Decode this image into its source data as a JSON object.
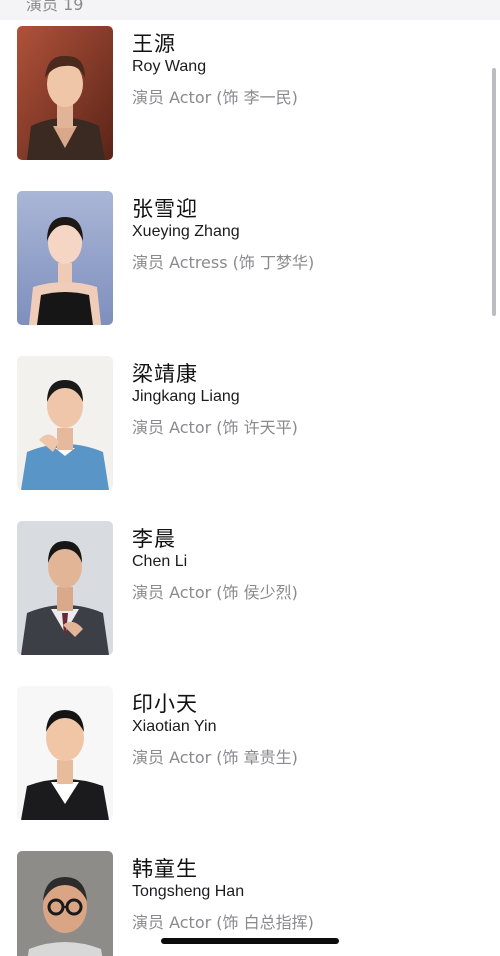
{
  "section": {
    "label": "演员 19"
  },
  "cast": [
    {
      "name_cn": "王源",
      "name_en": "Roy Wang",
      "role": "演员 Actor (饰 李一民)",
      "photo_icon": "actor-portrait-roy-wang"
    },
    {
      "name_cn": "张雪迎",
      "name_en": "Xueying Zhang",
      "role": "演员 Actress (饰 丁梦华)",
      "photo_icon": "actress-portrait-xueying-zhang"
    },
    {
      "name_cn": "梁靖康",
      "name_en": "Jingkang Liang",
      "role": "演员 Actor (饰 许天平)",
      "photo_icon": "actor-portrait-jingkang-liang"
    },
    {
      "name_cn": "李晨",
      "name_en": "Chen Li",
      "role": "演员 Actor (饰 侯少烈)",
      "photo_icon": "actor-portrait-chen-li"
    },
    {
      "name_cn": "印小天",
      "name_en": "Xiaotian Yin",
      "role": "演员 Actor (饰 章贵生)",
      "photo_icon": "actor-portrait-xiaotian-yin"
    },
    {
      "name_cn": "韩童生",
      "name_en": "Tongsheng Han",
      "role": "演员 Actor (饰 白总指挥)",
      "photo_icon": "actor-portrait-tongsheng-han"
    }
  ],
  "colors": {
    "primary_text": "#111111",
    "secondary_text": "#8a8a8e",
    "header_bg": "#f4f4f6"
  }
}
